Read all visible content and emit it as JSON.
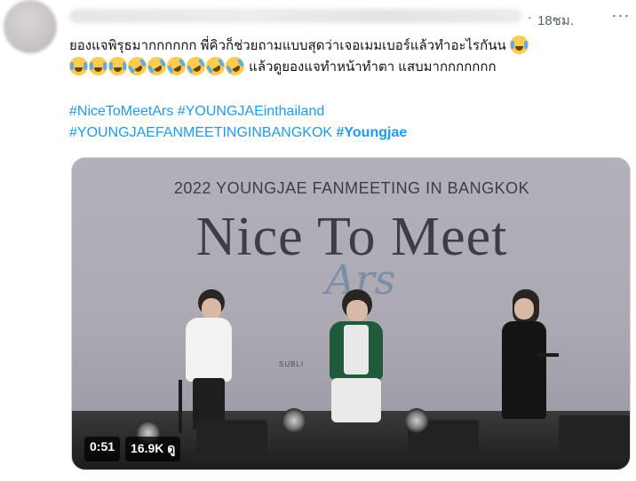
{
  "tweet": {
    "time": "18ชม.",
    "text_line1": "ยองแจพิรุธมากกกกกก พี่คิวก็ช่วยถามแบบสุดว่าเจอเมมเบอร์แล้วทำอะไรกันน",
    "text_line2_suffix": "แล้วดูยองแจทำหน้าทำตา แสบมากกกกกกก",
    "emoji_line1_end": "face-with-tears-of-joy",
    "emoji_line2": [
      "face-with-tears-of-joy",
      "face-with-tears-of-joy",
      "face-with-tears-of-joy",
      "rolling-on-floor-laughing",
      "rolling-on-floor-laughing",
      "rolling-on-floor-laughing",
      "rolling-on-floor-laughing",
      "rolling-on-floor-laughing",
      "rolling-on-floor-laughing"
    ],
    "hashtags": [
      "#NiceToMeetArs",
      "#YOUNGJAEinthailand",
      "#YOUNGJAEFANMEETINGINBANGKOK",
      "#Youngjae"
    ]
  },
  "media": {
    "screen_title": "2022 YOUNGJAE FANMEETING IN BANGKOK",
    "big_title": "Nice To Meet",
    "script_title": "Ars",
    "sub_logo": "SUBLI",
    "duration": "0:51",
    "views": "16.9K ดู"
  },
  "colors": {
    "link": "#1d9bf0",
    "text": "#0f1419",
    "muted": "#536471"
  }
}
